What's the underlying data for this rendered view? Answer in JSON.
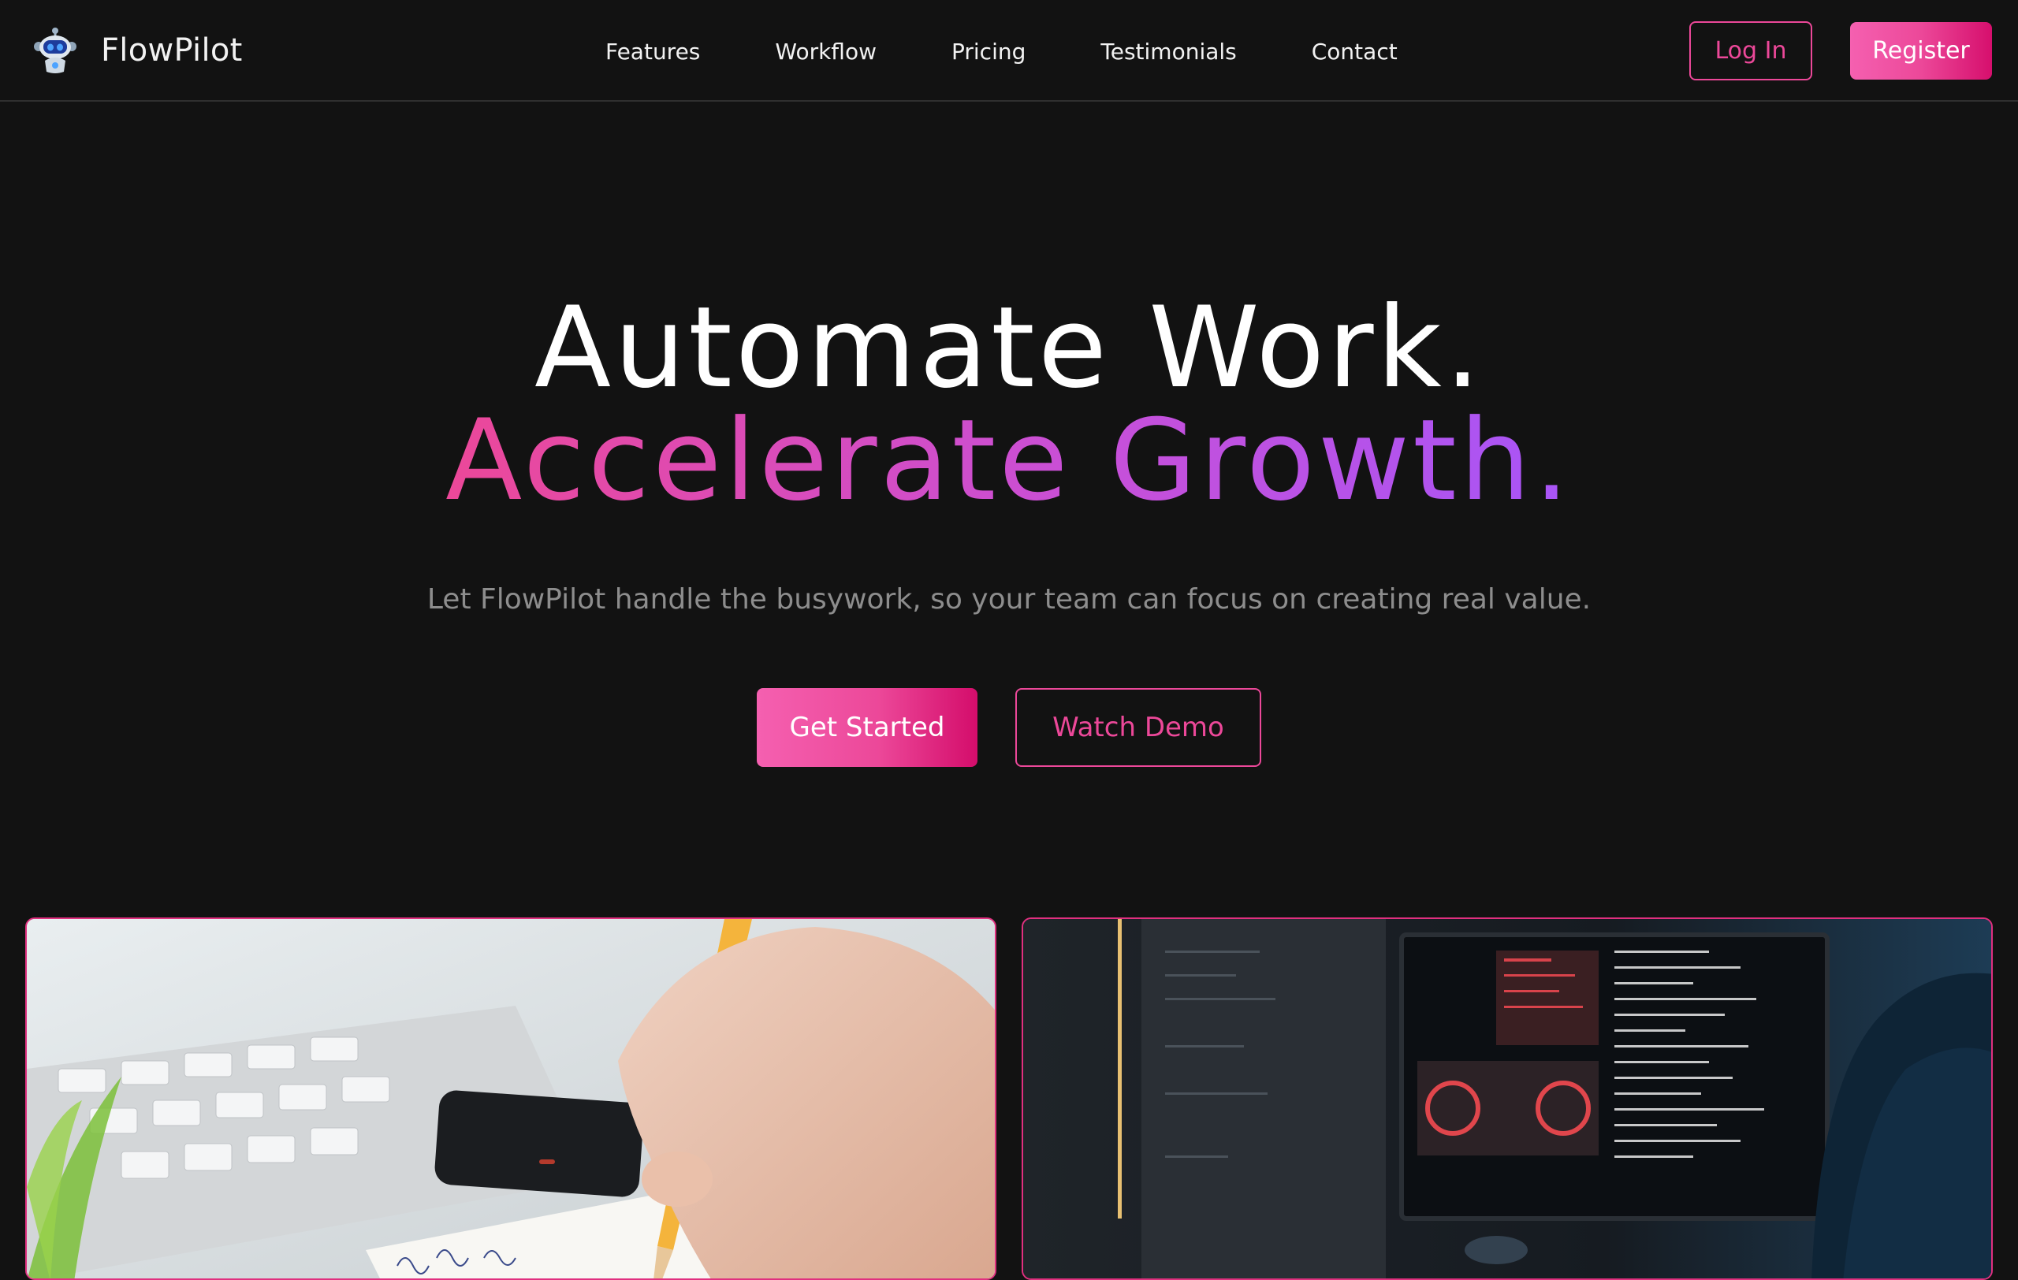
{
  "brand": {
    "name": "FlowPilot",
    "logo": "robot-logo-icon"
  },
  "nav": {
    "links": [
      "Features",
      "Workflow",
      "Pricing",
      "Testimonials",
      "Contact"
    ],
    "login_label": "Log In",
    "register_label": "Register"
  },
  "hero": {
    "title_line1": "Automate Work.",
    "title_line2": "Accelerate Growth.",
    "subtitle": "Let FlowPilot handle the busywork, so your team can focus on creating real value.",
    "cta_primary": "Get Started",
    "cta_secondary": "Watch Demo"
  },
  "images": [
    {
      "name": "hand-writing-notes-image"
    },
    {
      "name": "developer-monitor-code-image"
    }
  ],
  "colors": {
    "background": "#121212",
    "accent": "#ec4899",
    "accent_purple": "#a855f7",
    "subtitle": "#8d8d8d"
  }
}
